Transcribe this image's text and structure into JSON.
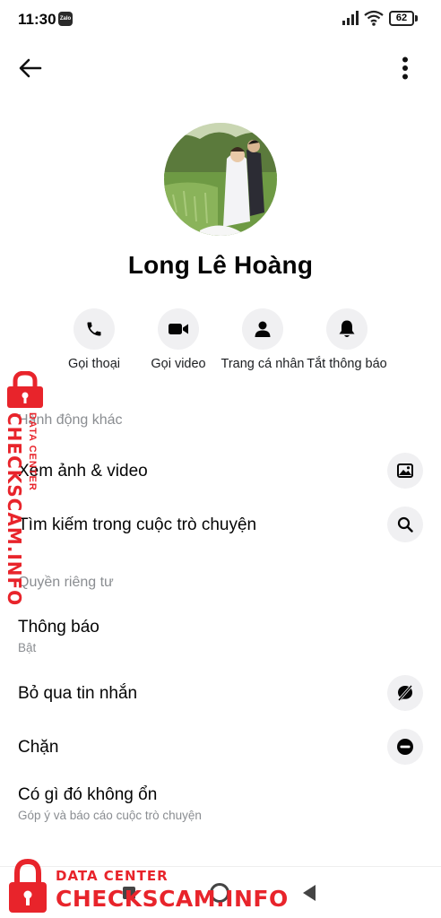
{
  "status_bar": {
    "time": "11:30",
    "notification_app": "Zalo",
    "battery": "62"
  },
  "profile": {
    "name": "Long Lê Hoàng"
  },
  "actions": [
    {
      "label": "Gọi thoại",
      "icon": "phone-icon"
    },
    {
      "label": "Gọi video",
      "icon": "video-camera-icon"
    },
    {
      "label": "Trang cá nhân",
      "icon": "person-icon"
    },
    {
      "label": "Tắt thông báo",
      "icon": "bell-icon"
    }
  ],
  "sections": {
    "other_actions": {
      "title": "Hành động khác",
      "items": [
        {
          "label": "Xem ảnh & video",
          "icon": "image-icon"
        },
        {
          "label": "Tìm kiếm trong cuộc trò chuyện",
          "icon": "search-icon"
        }
      ]
    },
    "privacy": {
      "title": "Quyền riêng tư",
      "notifications": {
        "label": "Thông báo",
        "value": "Bật"
      },
      "ignore": {
        "label": "Bỏ qua tin nhắn",
        "icon": "ignore-icon"
      },
      "block": {
        "label": "Chặn",
        "icon": "block-icon"
      },
      "report": {
        "label": "Có gì đó không ổn",
        "sub": "Góp ý và báo cáo cuộc trò chuyện"
      }
    }
  },
  "watermark": {
    "brand": "CHECKSCAM.INFO",
    "tagline": "DATA CENTER",
    "color": "#e8242b"
  }
}
